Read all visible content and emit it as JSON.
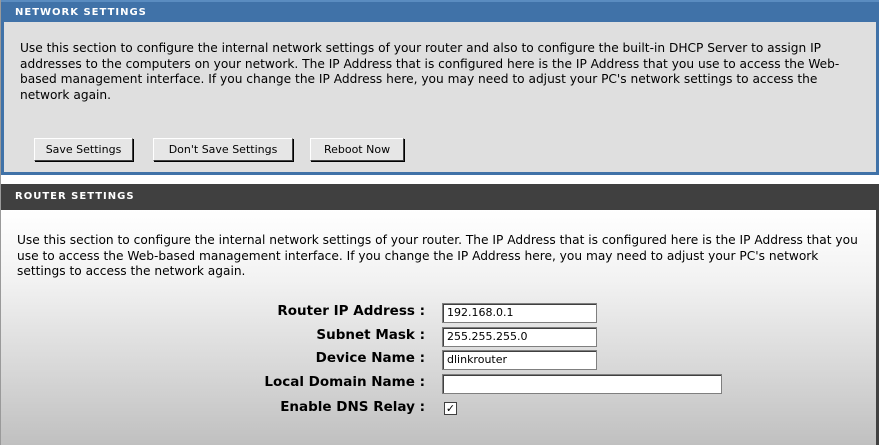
{
  "network_settings": {
    "header": "NETWORK SETTINGS",
    "description": "Use this section to configure the internal network settings of your router and also to configure the built-in DHCP Server to assign IP addresses to the computers on your network. The IP Address that is configured here is the IP Address that you use to access the Web-based management interface. If you change the IP Address here, you may need to adjust your PC's network settings to access the network again.",
    "buttons": {
      "save": "Save Settings",
      "dont_save": "Don't Save Settings",
      "reboot": "Reboot Now"
    }
  },
  "router_settings": {
    "header": "ROUTER SETTINGS",
    "description": "Use this section to configure the internal network settings of your router. The IP Address that is configured here is the IP Address that you use to access the Web-based management interface. If you change the IP Address here, you may need to adjust your PC's network settings to access the network again.",
    "fields": {
      "router_ip": {
        "label": "Router IP Address :",
        "value": "192.168.0.1"
      },
      "subnet_mask": {
        "label": "Subnet Mask :",
        "value": "255.255.255.0"
      },
      "device_name": {
        "label": "Device Name :",
        "value": "dlinkrouter"
      },
      "local_domain": {
        "label": "Local Domain Name :",
        "value": ""
      },
      "dns_relay": {
        "label": "Enable DNS Relay :",
        "checked": true,
        "check_glyph": "✓"
      }
    }
  },
  "colors": {
    "network_header": "#4072a8",
    "router_header": "#404040"
  }
}
